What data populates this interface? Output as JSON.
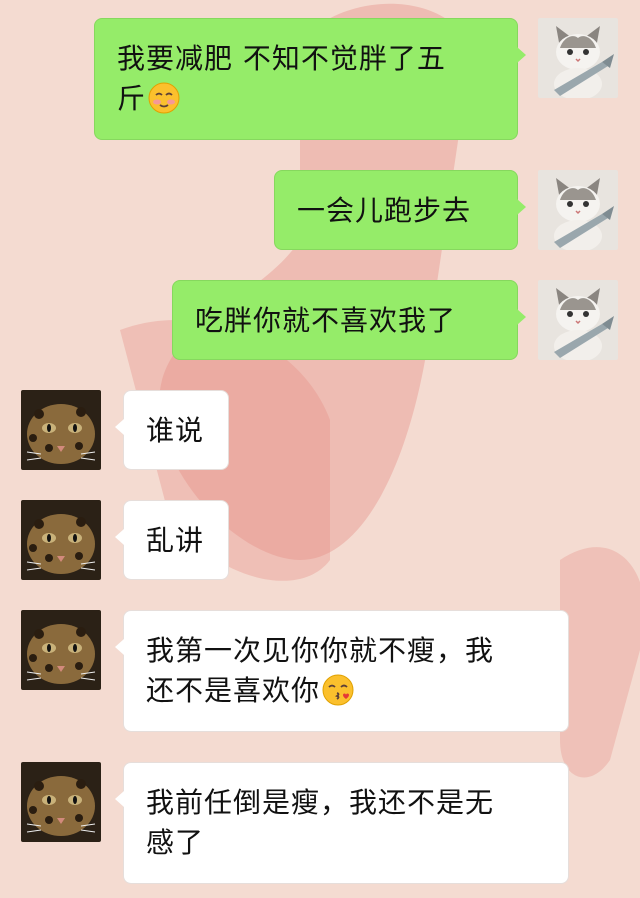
{
  "colors": {
    "background": "#f3d9cf",
    "sent_bubble": "#95ec69",
    "received_bubble": "#ffffff"
  },
  "messages": [
    {
      "side": "out",
      "text_line1": "我要减肥 不知不觉胖了五",
      "text_line2": "斤",
      "emoji": "smiling-blush-emoji"
    },
    {
      "side": "out",
      "text": "一会儿跑步去"
    },
    {
      "side": "out",
      "text": "吃胖你就不喜欢我了"
    },
    {
      "side": "in",
      "text": "谁说"
    },
    {
      "side": "in",
      "text": "乱讲"
    },
    {
      "side": "in",
      "text_line1": "我第一次见你你就不瘦，我",
      "text_line2": "还不是喜欢你",
      "emoji": "kissing-emoji"
    },
    {
      "side": "in",
      "text_line1": "我前任倒是瘦，我还不是无",
      "text_line2": "感了"
    }
  ],
  "avatars": {
    "sender": "cat-with-fish-avatar",
    "receiver": "leopard-cat-avatar"
  }
}
